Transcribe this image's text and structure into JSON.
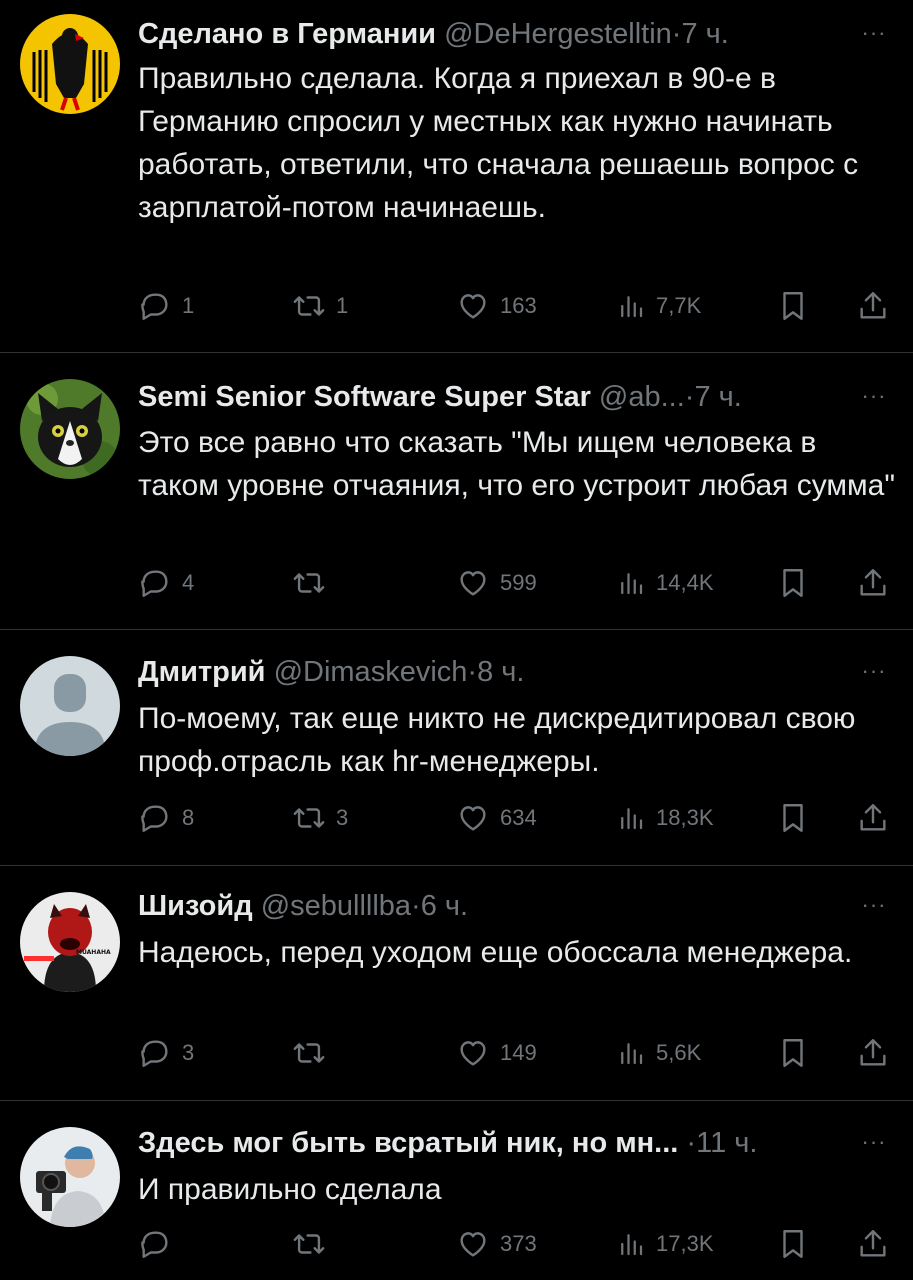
{
  "tweets": [
    {
      "name": "Сделано в Германии",
      "handle": "@DeHergestelltin",
      "time": "7 ч.",
      "text": "Правильно сделала. Когда я приехал в 90-е в Германию спросил у местных как нужно начинать работать, ответили, что сначала решаешь вопрос с зарплатой-потом начинаешь.",
      "replies": "1",
      "retweets": "1",
      "likes": "163",
      "views": "7,7K",
      "avatar": "german-eagle-flag"
    },
    {
      "name": "Semi Senior Software Super Star",
      "handle": "@ab...",
      "time": "7 ч.",
      "text": "Это все равно что сказать \"Мы ищем человека в таком уровне отчаяния, что его устроит любая сумма\"",
      "replies": "4",
      "retweets": "",
      "likes": "599",
      "views": "14,4K",
      "avatar": "tuxedo-cat"
    },
    {
      "name": "Дмитрий",
      "handle": "@Dimaskevich",
      "time": "8 ч.",
      "text": "По-моему, так еще никто не дискредитировал свою проф.отрасль как hr-менеджеры.",
      "replies": "8",
      "retweets": "3",
      "likes": "634",
      "views": "18,3K",
      "avatar": "default-person"
    },
    {
      "name": "Шизойд",
      "handle": "@sebullllba",
      "time": "6 ч.",
      "text": "Надеюсь, перед уходом еще обоссала менеджера.",
      "replies": "3",
      "retweets": "",
      "likes": "149",
      "views": "5,6K",
      "avatar": "red-character",
      "avatar_text": "MUAHAHA"
    },
    {
      "name": "Здесь мог быть всратый ник, но мн...",
      "handle": "",
      "time": "11 ч.",
      "text": "И правильно сделала",
      "replies": "",
      "retweets": "",
      "likes": "373",
      "views": "17,3K",
      "avatar": "person-with-camera"
    }
  ],
  "ui": {
    "dot": "·",
    "more": "···"
  },
  "colors": {
    "background": "#000000",
    "text": "#e7e9ea",
    "muted": "#71767b",
    "divider": "#2f3336"
  }
}
